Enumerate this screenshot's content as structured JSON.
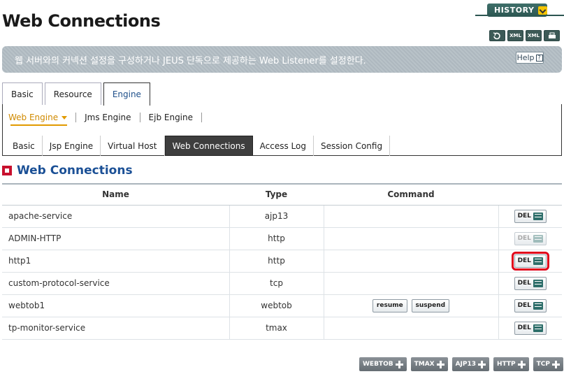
{
  "header": {
    "title": "Web Connections",
    "history_label": "HISTORY",
    "icons": [
      {
        "name": "refresh-icon",
        "label": ""
      },
      {
        "name": "xml-export-icon",
        "label": "XML"
      },
      {
        "name": "xml-view-icon",
        "label": "XML"
      },
      {
        "name": "print-icon",
        "label": ""
      }
    ],
    "description": "웹 서버와의 커넥션 설정을 구성하거나 JEUS 단독으로 제공하는 Web Listener를 설정한다.",
    "help_label": "Help",
    "help_icon_glyph": "?"
  },
  "tabs": {
    "primary": [
      {
        "label": "Basic",
        "active": false
      },
      {
        "label": "Resource",
        "active": false
      },
      {
        "label": "Engine",
        "active": true
      }
    ],
    "submenu": [
      {
        "label": "Web Engine",
        "active": true
      },
      {
        "label": "Jms Engine",
        "active": false
      },
      {
        "label": "Ejb Engine",
        "active": false
      }
    ],
    "secondary": [
      {
        "label": "Basic",
        "active": false
      },
      {
        "label": "Jsp Engine",
        "active": false
      },
      {
        "label": "Virtual Host",
        "active": false
      },
      {
        "label": "Web Connections",
        "active": true
      },
      {
        "label": "Access Log",
        "active": false
      },
      {
        "label": "Session Config",
        "active": false
      }
    ]
  },
  "section": {
    "title": "Web Connections"
  },
  "table": {
    "headers": {
      "name": "Name",
      "type": "Type",
      "command": "Command"
    },
    "rows": [
      {
        "name": "apache-service",
        "type": "ajp13",
        "commands": [],
        "del_label": "DEL",
        "del_state": "normal"
      },
      {
        "name": "ADMIN-HTTP",
        "type": "http",
        "commands": [],
        "del_label": "DEL",
        "del_state": "disabled"
      },
      {
        "name": "http1",
        "type": "http",
        "commands": [],
        "del_label": "DEL",
        "del_state": "highlighted"
      },
      {
        "name": "custom-protocol-service",
        "type": "tcp",
        "commands": [],
        "del_label": "DEL",
        "del_state": "normal"
      },
      {
        "name": "webtob1",
        "type": "webtob",
        "commands": [
          "resume",
          "suspend"
        ],
        "del_label": "DEL",
        "del_state": "normal"
      },
      {
        "name": "tp-monitor-service",
        "type": "tmax",
        "commands": [],
        "del_label": "DEL",
        "del_state": "normal"
      }
    ]
  },
  "add_buttons": [
    "WEBTOB",
    "TMAX",
    "AJP13",
    "HTTP",
    "TCP"
  ],
  "colors": {
    "accent_blue": "#1b5096",
    "active_submenu": "#e19a00",
    "highlight_red": "#e0001a",
    "header_teal": "#2b5651"
  }
}
